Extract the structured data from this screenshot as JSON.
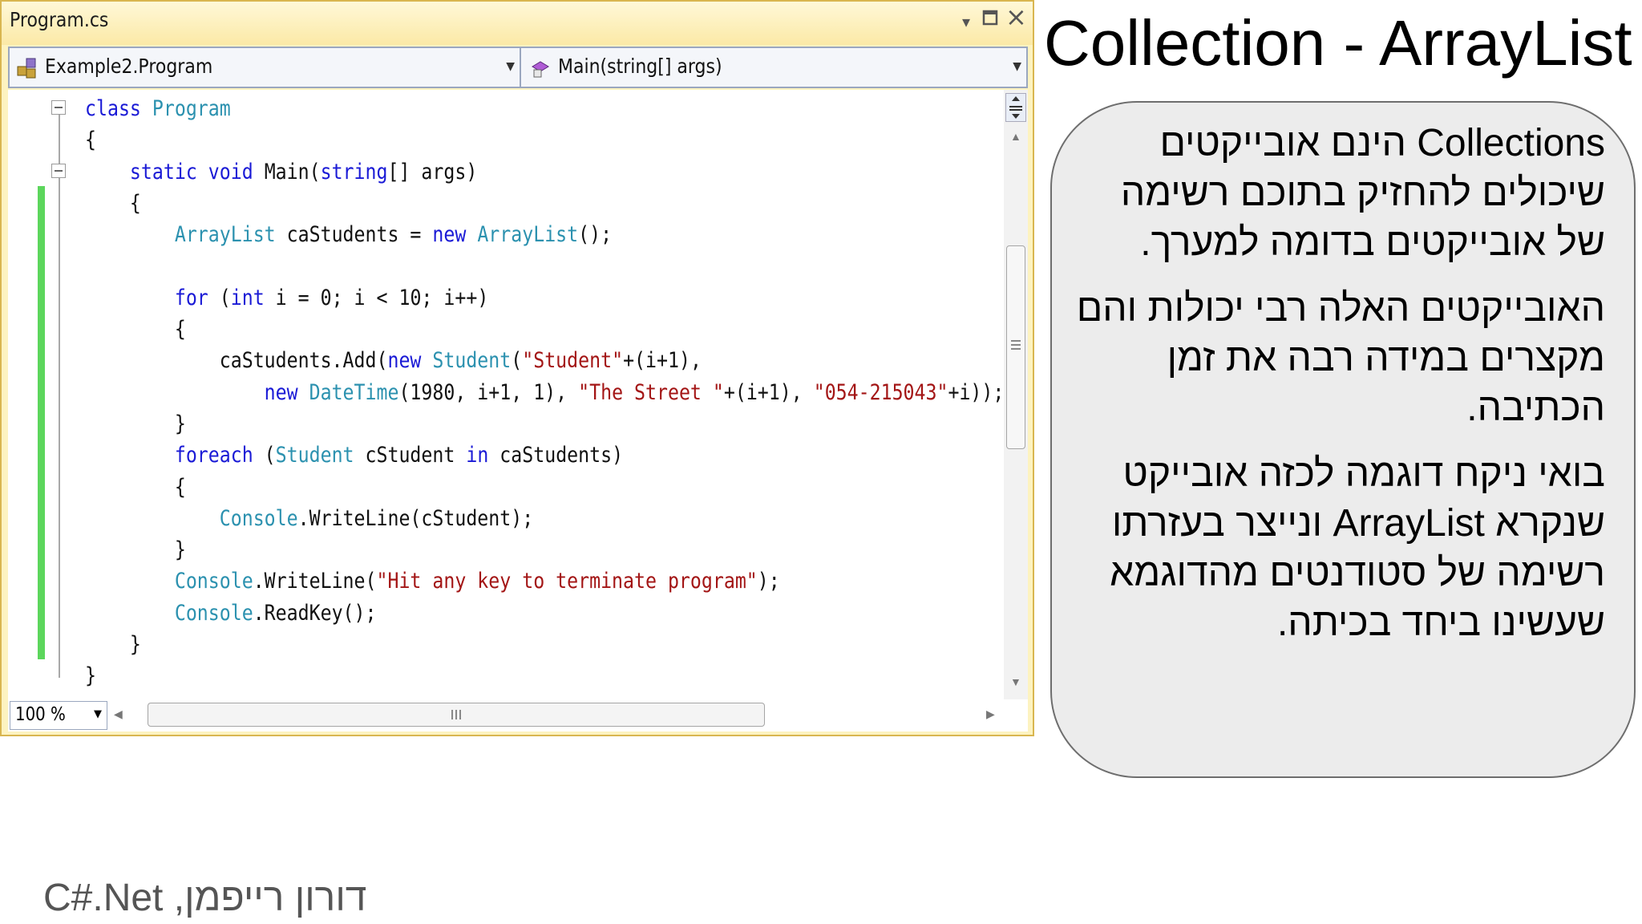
{
  "window": {
    "tab_title": "Program.cs",
    "controls": {
      "dropdown": "▾",
      "restore": "▫",
      "close": "×"
    }
  },
  "navigation": {
    "class_combo": "Example2.Program",
    "member_combo": "Main(string[] args)"
  },
  "code_lines": [
    [
      {
        "t": "class ",
        "c": "kw"
      },
      {
        "t": "Program",
        "c": "ty"
      }
    ],
    [
      {
        "t": "{",
        "c": ""
      }
    ],
    [
      {
        "t": "    "
      },
      {
        "t": "static ",
        "c": "kw"
      },
      {
        "t": "void ",
        "c": "kw"
      },
      {
        "t": "Main(",
        "c": ""
      },
      {
        "t": "string",
        "c": "kw"
      },
      {
        "t": "[] args)",
        "c": ""
      }
    ],
    [
      {
        "t": "    {",
        "c": ""
      }
    ],
    [
      {
        "t": "        "
      },
      {
        "t": "ArrayList",
        "c": "ty"
      },
      {
        "t": " caStudents = ",
        "c": ""
      },
      {
        "t": "new ",
        "c": "kw"
      },
      {
        "t": "ArrayList",
        "c": "ty"
      },
      {
        "t": "();",
        "c": ""
      }
    ],
    [
      {
        "t": ""
      }
    ],
    [
      {
        "t": "        "
      },
      {
        "t": "for ",
        "c": "kw"
      },
      {
        "t": "(",
        "c": ""
      },
      {
        "t": "int ",
        "c": "kw"
      },
      {
        "t": "i = 0; i < 10; i++)",
        "c": ""
      }
    ],
    [
      {
        "t": "        {",
        "c": ""
      }
    ],
    [
      {
        "t": "            caStudents.Add(",
        "c": ""
      },
      {
        "t": "new ",
        "c": "kw"
      },
      {
        "t": "Student",
        "c": "ty"
      },
      {
        "t": "(",
        "c": ""
      },
      {
        "t": "\"Student\"",
        "c": "st"
      },
      {
        "t": "+(i+1),",
        "c": ""
      }
    ],
    [
      {
        "t": "                "
      },
      {
        "t": "new ",
        "c": "kw"
      },
      {
        "t": "DateTime",
        "c": "ty"
      },
      {
        "t": "(1980, i+1, 1), ",
        "c": ""
      },
      {
        "t": "\"The Street \"",
        "c": "st"
      },
      {
        "t": "+(i+1), ",
        "c": ""
      },
      {
        "t": "\"054-215043\"",
        "c": "st"
      },
      {
        "t": "+i));",
        "c": ""
      }
    ],
    [
      {
        "t": "        }",
        "c": ""
      }
    ],
    [
      {
        "t": "        "
      },
      {
        "t": "foreach ",
        "c": "kw"
      },
      {
        "t": "(",
        "c": ""
      },
      {
        "t": "Student",
        "c": "ty"
      },
      {
        "t": " cStudent ",
        "c": ""
      },
      {
        "t": "in ",
        "c": "kw"
      },
      {
        "t": "caStudents)",
        "c": ""
      }
    ],
    [
      {
        "t": "        {",
        "c": ""
      }
    ],
    [
      {
        "t": "            "
      },
      {
        "t": "Console",
        "c": "ty"
      },
      {
        "t": ".WriteLine(cStudent);",
        "c": ""
      }
    ],
    [
      {
        "t": "        }",
        "c": ""
      }
    ],
    [
      {
        "t": "        "
      },
      {
        "t": "Console",
        "c": "ty"
      },
      {
        "t": ".WriteLine(",
        "c": ""
      },
      {
        "t": "\"Hit any key to terminate program\"",
        "c": "st"
      },
      {
        "t": ");",
        "c": ""
      }
    ],
    [
      {
        "t": "        "
      },
      {
        "t": "Console",
        "c": "ty"
      },
      {
        "t": ".ReadKey();",
        "c": ""
      }
    ],
    [
      {
        "t": "    }",
        "c": ""
      }
    ],
    [
      {
        "t": "}",
        "c": ""
      }
    ]
  ],
  "status": {
    "zoom": "100 %"
  },
  "slide": {
    "title": "Collection - ArrayList",
    "paragraphs": [
      "Collections הינם אובייקטים שיכולים להחזיק בתוכם רשימה של אובייקטים בדומה למערך.",
      "האובייקטים האלה רבי יכולות והם מקצרים במידה רבה את זמן הכתיבה.",
      "בואי ניקח דוגמה לכזה אובייקט שנקרא ArrayList ונייצר בעזרתו רשימה של סטודנטים מהדוגמא שעשינו ביחד בכיתה."
    ],
    "footer": "דורון רייפמן, C#.Net"
  },
  "colors": {
    "keyword": "#1a1ad6",
    "type": "#2b91af",
    "string": "#a31515",
    "change_bar": "#5cd65c",
    "window_border": "#d9b650"
  }
}
